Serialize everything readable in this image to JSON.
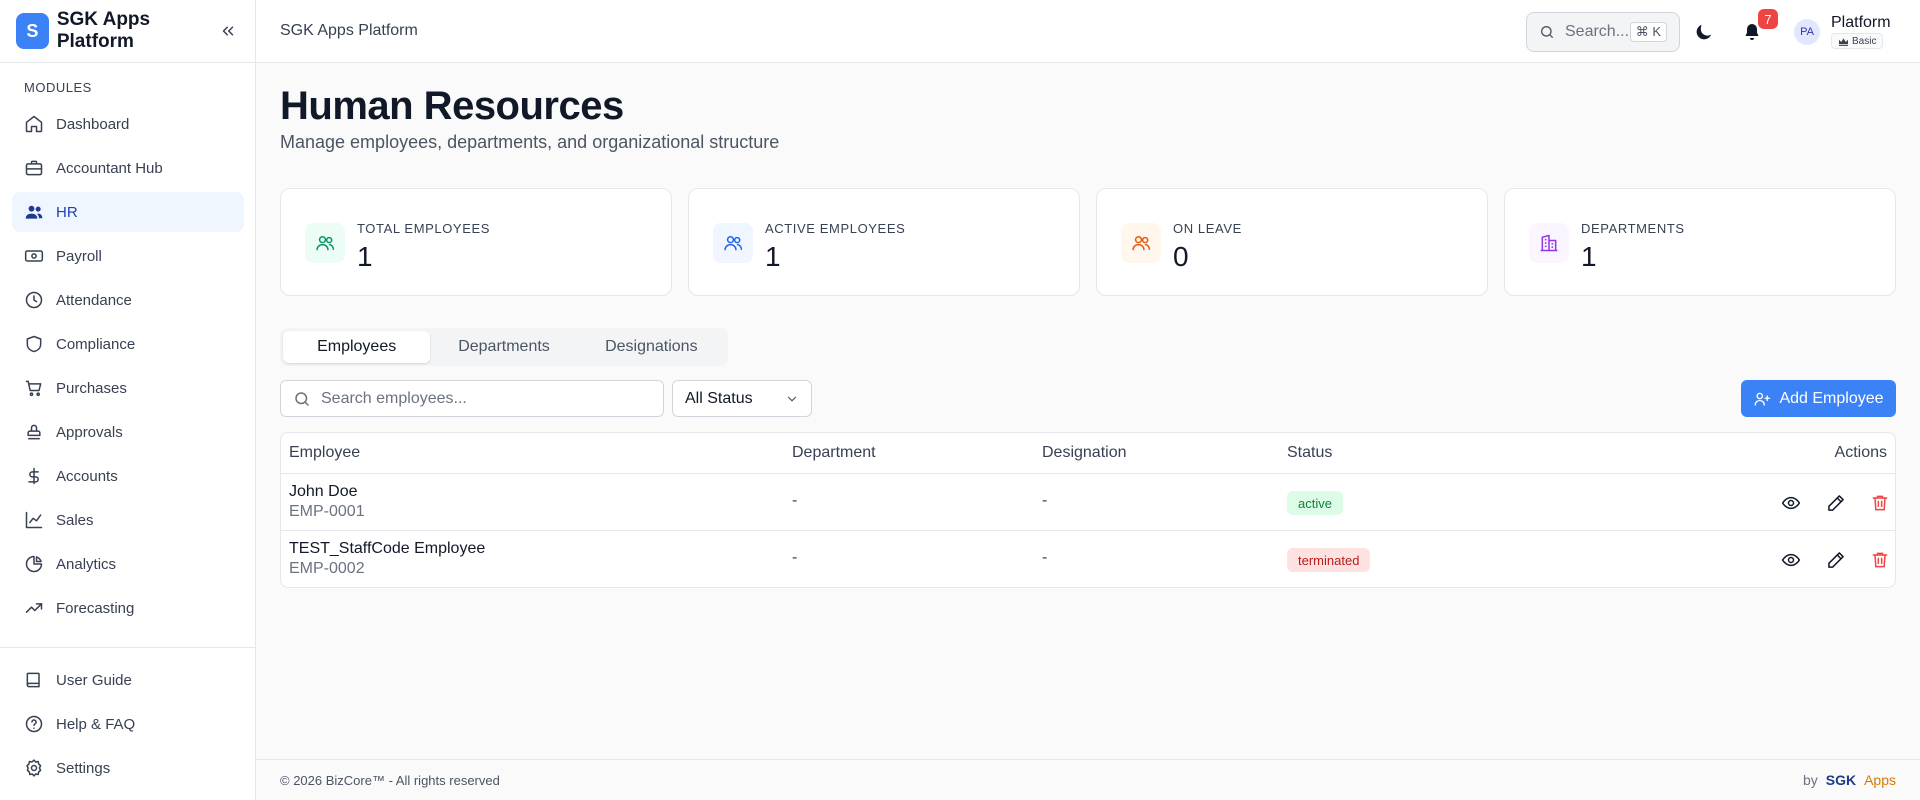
{
  "brand": {
    "logo_letter": "S",
    "name": "SGK Apps Platform"
  },
  "sidebar": {
    "modules_label": "MODULES",
    "items": [
      {
        "label": "Dashboard",
        "icon": "home-icon"
      },
      {
        "label": "Accountant Hub",
        "icon": "briefcase-icon"
      },
      {
        "label": "HR",
        "icon": "users-icon",
        "active": true
      },
      {
        "label": "Payroll",
        "icon": "banknote-icon"
      },
      {
        "label": "Attendance",
        "icon": "clock-icon"
      },
      {
        "label": "Compliance",
        "icon": "shield-icon"
      },
      {
        "label": "Purchases",
        "icon": "cart-icon"
      },
      {
        "label": "Approvals",
        "icon": "stamp-icon"
      },
      {
        "label": "Accounts",
        "icon": "dollar-icon"
      },
      {
        "label": "Sales",
        "icon": "chart-line-icon"
      },
      {
        "label": "Analytics",
        "icon": "pie-chart-icon"
      },
      {
        "label": "Forecasting",
        "icon": "trending-up-icon"
      }
    ],
    "bottom_items": [
      {
        "label": "User Guide",
        "icon": "book-icon"
      },
      {
        "label": "Help & FAQ",
        "icon": "help-circle-icon"
      },
      {
        "label": "Settings",
        "icon": "gear-icon"
      }
    ]
  },
  "header": {
    "title": "SGK Apps Platform",
    "search_label": "Search...",
    "search_shortcut": "⌘ K",
    "notification_count": "7",
    "avatar_initials": "PA",
    "account_name": "Platform",
    "plan": "Basic"
  },
  "page": {
    "title": "Human Resources",
    "subtitle": "Manage employees, departments, and organizational structure"
  },
  "stats": [
    {
      "label": "TOTAL EMPLOYEES",
      "value": "1",
      "icon": "users-icon",
      "bg": "#ecfdf5",
      "color": "#059669"
    },
    {
      "label": "ACTIVE EMPLOYEES",
      "value": "1",
      "icon": "users-icon",
      "bg": "#eff6ff",
      "color": "#2563eb"
    },
    {
      "label": "ON LEAVE",
      "value": "0",
      "icon": "users-icon",
      "bg": "#fff7ed",
      "color": "#ea580c"
    },
    {
      "label": "DEPARTMENTS",
      "value": "1",
      "icon": "building-icon",
      "bg": "#faf5ff",
      "color": "#9333ea"
    }
  ],
  "tabs": [
    {
      "label": "Employees",
      "active": true
    },
    {
      "label": "Departments"
    },
    {
      "label": "Designations"
    }
  ],
  "filters": {
    "search_placeholder": "Search employees...",
    "status_value": "All Status",
    "add_button": "Add Employee"
  },
  "table": {
    "columns": [
      "Employee",
      "Department",
      "Designation",
      "Status",
      "Actions"
    ],
    "rows": [
      {
        "name": "John Doe",
        "code": "EMP-0001",
        "department": "-",
        "designation": "-",
        "status": "active"
      },
      {
        "name": "TEST_StaffCode Employee",
        "code": "EMP-0002",
        "department": "-",
        "designation": "-",
        "status": "terminated"
      }
    ]
  },
  "footer": {
    "copyright": "© 2026 BizCore™ - All rights reserved",
    "by": "by",
    "brand1": "SGK",
    "brand2": "Apps"
  },
  "colors": {
    "accent": "#3b82f6",
    "active_bg": "#eff6ff",
    "danger": "#ef4444"
  }
}
